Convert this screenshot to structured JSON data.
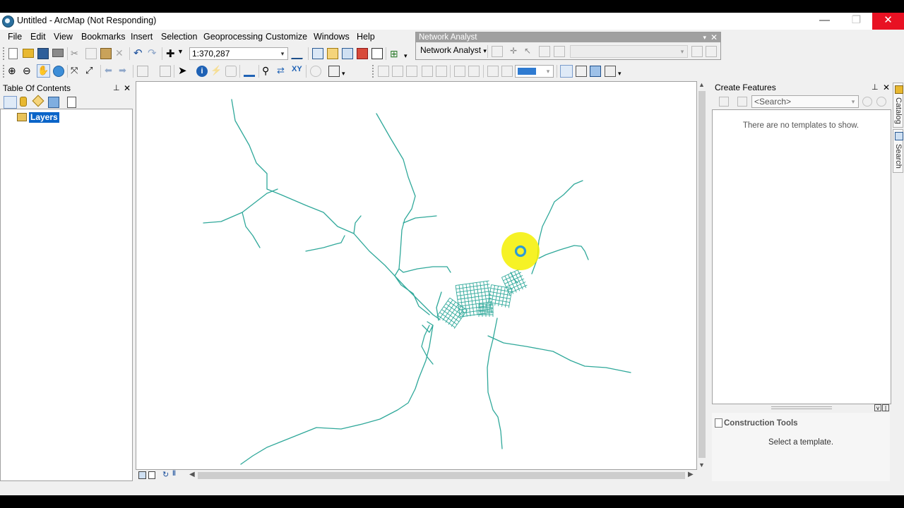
{
  "window": {
    "title": "Untitled - ArcMap (Not Responding)",
    "minimize_glyph": "—",
    "maximize_glyph": "❐",
    "close_glyph": "✕"
  },
  "menu": [
    "File",
    "Edit",
    "View",
    "Bookmarks",
    "Insert",
    "Selection",
    "Geoprocessing",
    "Customize",
    "Windows",
    "Help"
  ],
  "standard_toolbar": {
    "scale_value": "1:370,287",
    "dropdown_glyph": "▾"
  },
  "network_analyst": {
    "title": "Network Analyst",
    "menu_label": "Network Analyst",
    "menu_arrow": "▾",
    "close_glyph": "✕",
    "dropdown_glyph": "▾"
  },
  "toc": {
    "title": "Table Of Contents",
    "pin_glyph": "⊥",
    "close_glyph": "✕",
    "root_layer": "Layers"
  },
  "create_features": {
    "title": "Create Features",
    "pin_glyph": "⊥",
    "close_glyph": "✕",
    "search_placeholder": "<Search>",
    "empty_message": "There are no templates to show.",
    "construction_title": "Construction Tools",
    "construction_message": "Select a template."
  },
  "side_tabs": [
    "Catalog",
    "Search"
  ],
  "map": {
    "highlight_color": "#f4f000",
    "road_color": "#2fa89a",
    "marker_color": "#2e9bd6"
  },
  "scroll": {
    "up": "▲",
    "down": "▼",
    "left": "◀",
    "right": "▶"
  }
}
